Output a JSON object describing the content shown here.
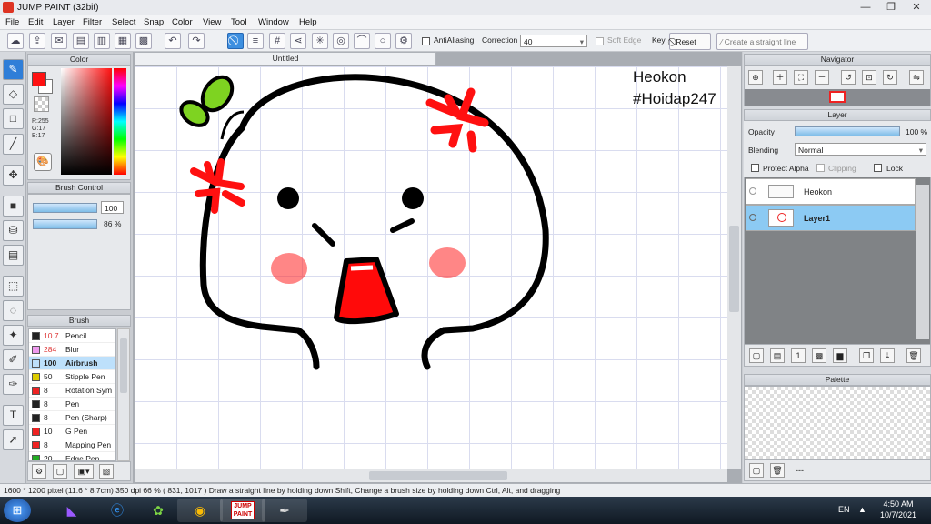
{
  "window": {
    "title": "JUMP PAINT (32bit)"
  },
  "menu": [
    "File",
    "Edit",
    "Layer",
    "Filter",
    "Select",
    "Snap",
    "Color",
    "View",
    "Tool",
    "Window",
    "Help"
  ],
  "toolbar": {
    "antialias_label": "AntiAliasing",
    "correction_label": "Correction",
    "correction_value": "40",
    "soft_edge_label": "Soft Edge",
    "key_label": "Key",
    "reset_label": "Reset",
    "straight_line_label": "Create a straight line"
  },
  "color_panel": {
    "title": "Color",
    "r": "R:255",
    "g": "G:17",
    "b": "B:17",
    "primary": "#ff1111",
    "secondary": "#ffffff"
  },
  "brush_control": {
    "title": "Brush Control",
    "size_value": "100",
    "opacity_value": "86 %",
    "size_fraction": 0.95,
    "opacity_fraction": 0.86
  },
  "brush_panel": {
    "title": "Brush",
    "items": [
      {
        "size": "10.7",
        "name": "Pencil",
        "color": "#222222"
      },
      {
        "size": "284",
        "name": "Blur",
        "color": "#ee99ee"
      },
      {
        "size": "100",
        "name": "Airbrush",
        "color": "#bde0fb",
        "selected": true
      },
      {
        "size": "50",
        "name": "Stipple Pen",
        "color": "#ddcc00"
      },
      {
        "size": "8",
        "name": "Rotation Sym",
        "color": "#ee2222"
      },
      {
        "size": "8",
        "name": "Pen",
        "color": "#222222"
      },
      {
        "size": "8",
        "name": "Pen (Sharp)",
        "color": "#222222"
      },
      {
        "size": "10",
        "name": "G Pen",
        "color": "#ee2222"
      },
      {
        "size": "8",
        "name": "Mapping Pen",
        "color": "#ee2222"
      },
      {
        "size": "20",
        "name": "Edge Pen",
        "color": "#22aa22"
      }
    ]
  },
  "canvas": {
    "tab": "Untitled",
    "text1": "Heokon",
    "text2": "#Hoidap247"
  },
  "navigator": {
    "title": "Navigator"
  },
  "layer_panel": {
    "title": "Layer",
    "opacity_label": "Opacity",
    "opacity_value": "100 %",
    "blending_label": "Blending",
    "blending_value": "Normal",
    "protect_alpha": "Protect Alpha",
    "clipping": "Clipping",
    "lock": "Lock",
    "layers": [
      {
        "name": "Heokon",
        "selected": false
      },
      {
        "name": "Layer1",
        "selected": true
      }
    ]
  },
  "palette": {
    "title": "Palette",
    "dash": "---"
  },
  "status": {
    "text": "1600 * 1200 pixel   (11.6 * 8.7cm)   350 dpi   66 %   ( 831, 1017 )   Draw a straight line by holding down Shift, Change a brush size by holding down Ctrl, Alt, and dragging"
  },
  "taskbar": {
    "lang": "EN",
    "time": "4:50 AM",
    "date": "10/7/2021"
  }
}
